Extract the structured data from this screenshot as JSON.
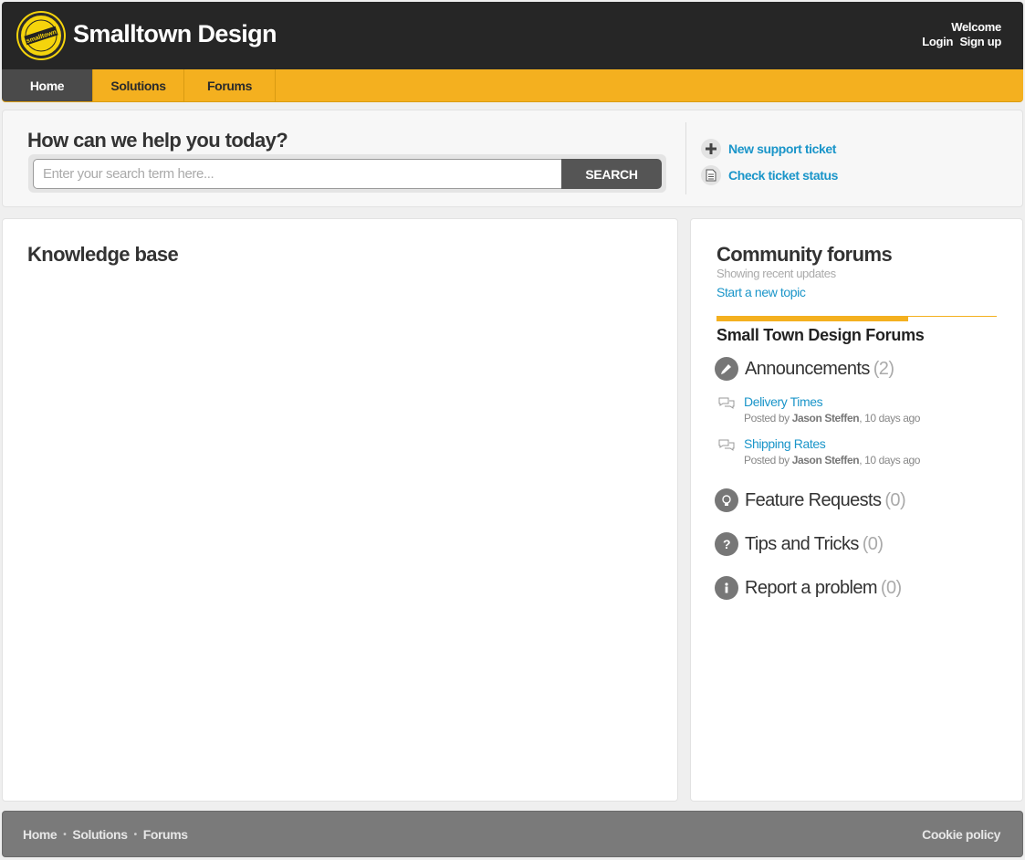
{
  "header": {
    "brand": "Smalltown Design",
    "logo_text": "smalltown",
    "welcome": "Welcome",
    "login": "Login",
    "signup": "Sign up"
  },
  "nav": {
    "tabs": [
      {
        "label": "Home",
        "active": true
      },
      {
        "label": "Solutions",
        "active": false
      },
      {
        "label": "Forums",
        "active": false
      }
    ]
  },
  "help": {
    "title": "How can we help you today?",
    "search_placeholder": "Enter your search term here...",
    "search_button": "SEARCH",
    "links": [
      {
        "label": "New support ticket",
        "icon": "plus-icon"
      },
      {
        "label": "Check ticket status",
        "icon": "document-icon"
      }
    ]
  },
  "knowledge_base": {
    "title": "Knowledge base"
  },
  "community": {
    "title": "Community forums",
    "subtitle": "Showing recent updates",
    "start_topic": "Start a new topic",
    "forum_name": "Small Town Design Forums",
    "categories": [
      {
        "name": "Announcements",
        "count": "(2)",
        "icon": "megaphone-icon"
      },
      {
        "name": "Feature Requests",
        "count": "(0)",
        "icon": "lightbulb-icon"
      },
      {
        "name": "Tips and Tricks",
        "count": "(0)",
        "icon": "question-icon"
      },
      {
        "name": "Report a problem",
        "count": "(0)",
        "icon": "info-icon"
      }
    ],
    "topics": [
      {
        "title": "Delivery Times",
        "posted_by": "Posted by",
        "author": "Jason Steffen",
        "when": ", 10 days ago"
      },
      {
        "title": "Shipping Rates",
        "posted_by": "Posted by",
        "author": "Jason Steffen",
        "when": ", 10 days ago"
      }
    ]
  },
  "footer": {
    "links": [
      "Home",
      "Solutions",
      "Forums"
    ],
    "separator": "•",
    "cookie": "Cookie policy"
  },
  "colors": {
    "header_bg": "#262626",
    "nav_bg": "#f4b01f",
    "link": "#1a95c9",
    "footer_bg": "#7a7a7a"
  }
}
